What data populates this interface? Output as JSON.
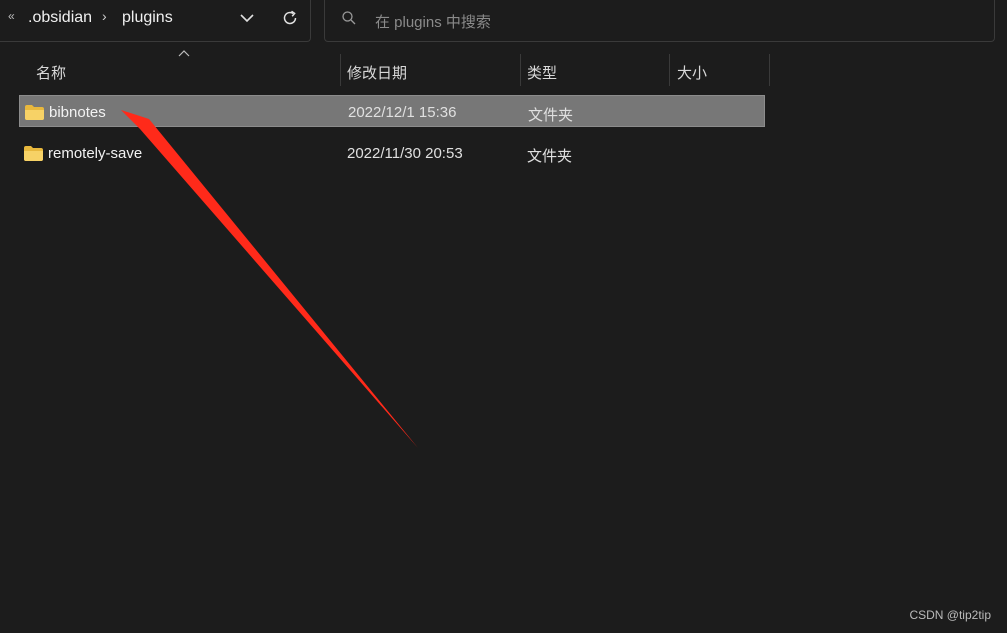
{
  "address_bar": {
    "overflow_label": "«",
    "breadcrumbs": [
      ".obsidian",
      "plugins"
    ],
    "separator": "›"
  },
  "search": {
    "placeholder": "在 plugins 中搜索"
  },
  "columns": {
    "name": "名称",
    "modified": "修改日期",
    "type": "类型",
    "size": "大小"
  },
  "files": [
    {
      "name": "bibnotes",
      "modified": "2022/12/1 15:36",
      "type": "文件夹",
      "size": "",
      "selected": true
    },
    {
      "name": "remotely-save",
      "modified": "2022/11/30 20:53",
      "type": "文件夹",
      "size": "",
      "selected": false
    }
  ],
  "annotation": {
    "color": "#ff2a1a"
  },
  "folder_color": "#e8b83d",
  "watermark": "CSDN @tip2tip"
}
